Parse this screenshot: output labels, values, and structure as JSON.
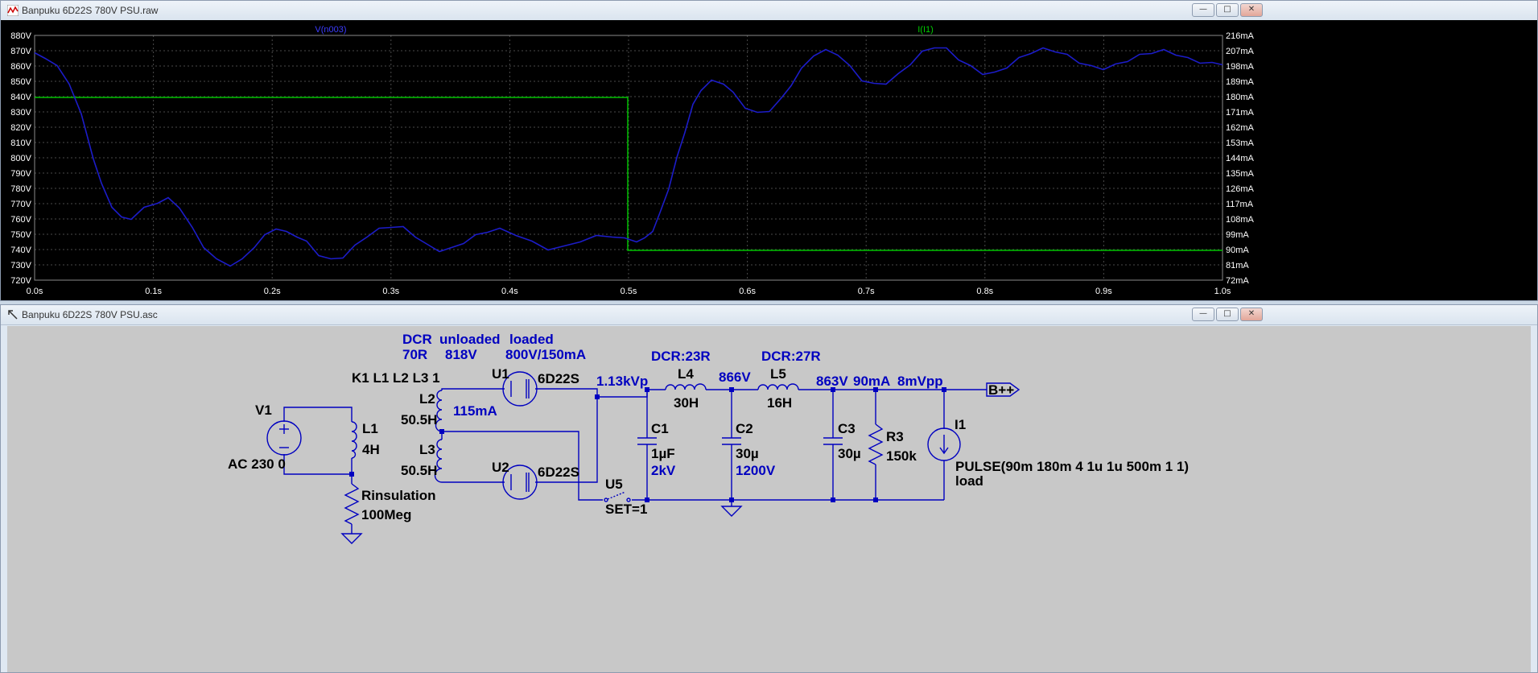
{
  "waveform_window": {
    "title": "Banpuku 6D22S 780V PSU.raw",
    "trace_labels": [
      "V(n003)",
      "I(I1)"
    ],
    "left_ticks": [
      "880V",
      "870V",
      "860V",
      "850V",
      "840V",
      "830V",
      "820V",
      "810V",
      "800V",
      "790V",
      "780V",
      "770V",
      "760V",
      "750V",
      "740V",
      "730V",
      "720V"
    ],
    "right_ticks": [
      "216mA",
      "207mA",
      "198mA",
      "189mA",
      "180mA",
      "171mA",
      "162mA",
      "153mA",
      "144mA",
      "135mA",
      "126mA",
      "117mA",
      "108mA",
      "99mA",
      "90mA",
      "81mA",
      "72mA"
    ],
    "x_ticks": [
      "0.0s",
      "0.1s",
      "0.2s",
      "0.3s",
      "0.4s",
      "0.5s",
      "0.6s",
      "0.7s",
      "0.8s",
      "0.9s",
      "1.0s"
    ],
    "colors": {
      "background": "#000000",
      "grid": "#4a4a4a",
      "voltage_trace": "#1c1cc8",
      "current_trace": "#00c000",
      "axis_text": "#ffffff"
    }
  },
  "schematic_window": {
    "title": "Banpuku 6D22S 780V PSU.asc",
    "labels": {
      "dcr_hdr": "DCR",
      "dcr_val": "70R",
      "unloaded_hdr": "unloaded",
      "unloaded_val": "818V",
      "loaded_hdr": "loaded",
      "loaded_val": "800V/150mA",
      "coupling": "K1 L1 L2 L3 1",
      "v1_name": "V1",
      "v1_value": "AC 230 0",
      "l1_name": "L1",
      "l1_value": "4H",
      "l2_name": "L2",
      "l2_value": "50.5H",
      "l2_current": "115mA",
      "l3_name": "L3",
      "l3_value": "50.5H",
      "rins_name": "Rinsulation",
      "rins_value": "100Meg",
      "u1_name": "U1",
      "u1_value": "6D22S",
      "u2_name": "U2",
      "u2_value": "6D22S",
      "u5_name": "U5",
      "u5_value": "SET=1",
      "ripple1": "1.13kVp",
      "l4_dcr": "DCR:23R",
      "l4_name": "L4",
      "l4_value": "30H",
      "node2": "866V",
      "l5_dcr": "DCR:27R",
      "l5_name": "L5",
      "l5_value": "16H",
      "node3": "863V",
      "load_current": "90mA",
      "ripple_out": "8mVpp",
      "bpp": "B++",
      "c1_name": "C1",
      "c1_value": "1µF",
      "c1_rating": "2kV",
      "c2_name": "C2",
      "c2_value": "30µ",
      "c2_rating": "1200V",
      "c3_name": "C3",
      "c3_value": "30µ",
      "r3_name": "R3",
      "r3_value": "150k",
      "i1_name": "I1",
      "i1_value": "PULSE(90m 180m 4 1u 1u 500m 1 1)",
      "i1_extra": "load"
    },
    "colors": {
      "background": "#c8c8c8",
      "wire": "#0000c0",
      "label_blue": "#0000c0",
      "label_black": "#000000"
    }
  }
}
